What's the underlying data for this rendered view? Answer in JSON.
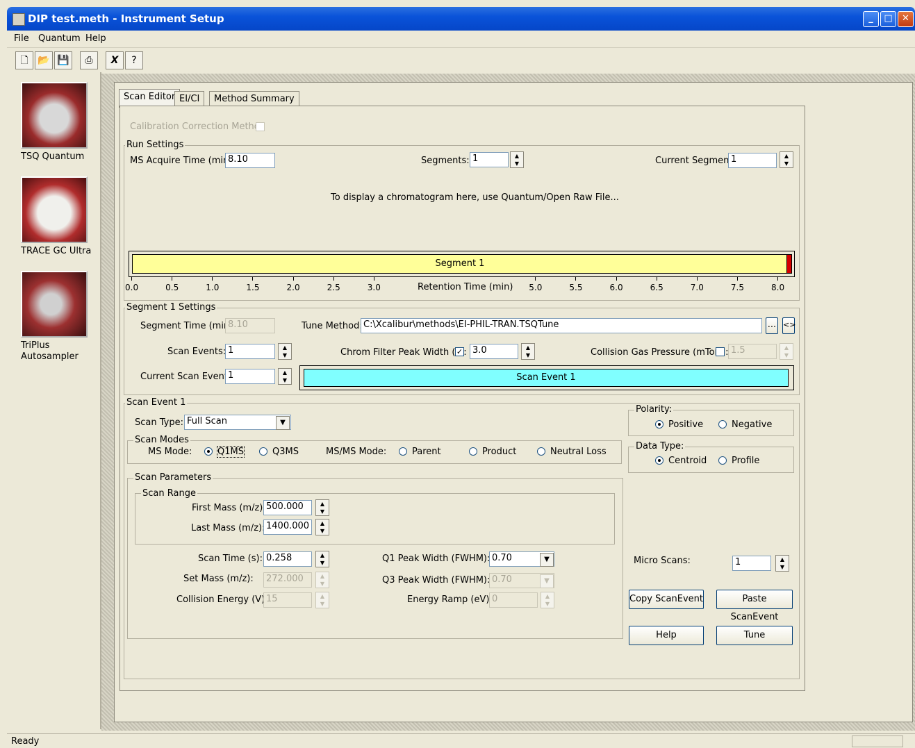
{
  "window": {
    "title": "DIP test.meth - Instrument Setup"
  },
  "menu": {
    "file": "File",
    "quantum": "Quantum",
    "help": "Help"
  },
  "toolbar": [
    "new-icon",
    "open-icon",
    "save-icon",
    "print-icon",
    "cut-icon",
    "help-question-icon"
  ],
  "nav": [
    {
      "label": "TSQ Quantum"
    },
    {
      "label": "TRACE GC Ultra"
    },
    {
      "label": "TriPlus\nAutosampler"
    }
  ],
  "tabs": [
    "Scan Editor",
    "EI/CI",
    "Method Summary"
  ],
  "calibration": {
    "label": "Calibration Correction Method"
  },
  "run_settings": {
    "title": "Run Settings",
    "ms_acquire_label": "MS Acquire Time (min):",
    "ms_acquire_value": "8.10",
    "segments_label": "Segments:",
    "segments_value": "1",
    "current_segment_label": "Current Segment:",
    "current_segment_value": "1",
    "chromatogram_msg": "To display a chromatogram here, use Quantum/Open Raw File...",
    "segment_bar_label": "Segment 1",
    "axis_label": "Retention Time (min)",
    "ticks": [
      "0.0",
      "0.5",
      "1.0",
      "1.5",
      "2.0",
      "2.5",
      "3.0",
      "5.0",
      "5.5",
      "6.0",
      "6.5",
      "7.0",
      "7.5",
      "8.0"
    ]
  },
  "segment_settings": {
    "title": "Segment 1 Settings",
    "segment_time_label": "Segment Time (min):",
    "segment_time_value": "8.10",
    "tune_method_label": "Tune Method:",
    "tune_method_value": "C:\\Xcalibur\\methods\\EI-PHIL-TRAN.TSQTune",
    "browse_label": "...",
    "compare_label": "<>",
    "scan_events_label": "Scan Events:",
    "scan_events_value": "1",
    "chrom_filter_label": "Chrom Filter Peak Width (s):",
    "chrom_filter_value": "3.0",
    "collision_gas_label": "Collision Gas Pressure (mTorr):",
    "collision_gas_value": "1.5",
    "current_scan_event_label": "Current Scan Event:",
    "current_scan_event_value": "1",
    "scan_event_bar_label": "Scan Event 1"
  },
  "scan_event": {
    "title": "Scan Event 1",
    "scan_type_label": "Scan Type:",
    "scan_type_value": "Full Scan",
    "scan_modes_title": "Scan Modes",
    "ms_mode_label": "MS Mode:",
    "q1ms": "Q1MS",
    "q3ms": "Q3MS",
    "msms_mode_label": "MS/MS Mode:",
    "parent": "Parent",
    "product": "Product",
    "neutral_loss": "Neutral Loss",
    "scan_params_title": "Scan Parameters",
    "scan_range_title": "Scan Range",
    "first_mass_label": "First Mass (m/z):",
    "first_mass_value": "500.000",
    "last_mass_label": "Last Mass (m/z):",
    "last_mass_value": "1400.000",
    "scan_time_label": "Scan Time (s):",
    "scan_time_value": "0.258",
    "set_mass_label": "Set Mass (m/z):",
    "set_mass_value": "272.000",
    "collision_energy_label": "Collision Energy (V):",
    "collision_energy_value": "15",
    "q1_peak_label": "Q1 Peak Width (FWHM):",
    "q1_peak_value": "0.70",
    "q3_peak_label": "Q3 Peak Width (FWHM):",
    "q3_peak_value": "0.70",
    "energy_ramp_label": "Energy Ramp (eV):",
    "energy_ramp_value": "0",
    "polarity_title": "Polarity:",
    "positive": "Positive",
    "negative": "Negative",
    "data_type_title": "Data Type:",
    "centroid": "Centroid",
    "profile": "Profile",
    "micro_scans_label": "Micro Scans:",
    "micro_scans_value": "1",
    "copy_btn": "Copy ScanEvent",
    "paste_btn": "Paste ScanEvent",
    "help_btn": "Help",
    "tune_btn": "Tune"
  },
  "status": {
    "text": "Ready"
  },
  "colors": {
    "segment_bar": "#ffff99",
    "scan_event_bar": "#80ffff",
    "titlebar": "#0a53d9"
  }
}
